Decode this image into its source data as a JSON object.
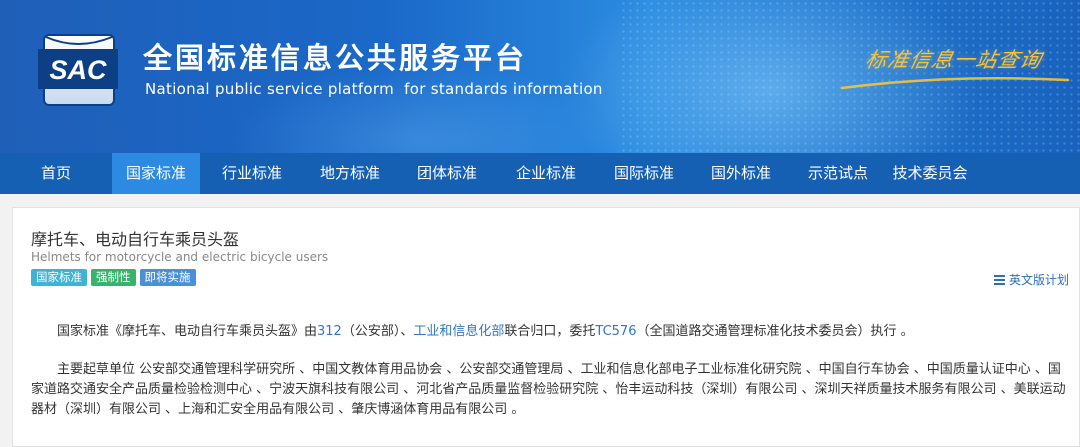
{
  "header": {
    "logo_text": "SAC",
    "title_cn": "全国标准信息公共服务平台",
    "title_en": "National public service platform  for standards information",
    "slogan": "标准信息一站查询"
  },
  "nav": {
    "items": [
      {
        "label": "首页",
        "active": false
      },
      {
        "label": "国家标准",
        "active": true
      },
      {
        "label": "行业标准",
        "active": false
      },
      {
        "label": "地方标准",
        "active": false
      },
      {
        "label": "团体标准",
        "active": false
      },
      {
        "label": "企业标准",
        "active": false
      },
      {
        "label": "国际标准",
        "active": false
      },
      {
        "label": "国外标准",
        "active": false
      },
      {
        "label": "示范试点",
        "active": false
      },
      {
        "label": "技术委员会",
        "active": false
      }
    ]
  },
  "standard": {
    "title": "摩托车、电动自行车乘员头盔",
    "title_en": "Helmets for motorcycle and electric bicycle users",
    "badges": [
      "国家标准",
      "强制性",
      "即将实施"
    ],
    "english_plan_link": "英文版计划",
    "para1": {
      "prefix": "国家标准《摩托车、电动自行车乘员头盔》由",
      "dept_code": "312",
      "dept_text": "（公安部）、",
      "ministry_link": "工业和信息化部",
      "mid_text": "联合归口，委托",
      "tc_link": "TC576",
      "suffix": "（全国道路交通管理标准化技术委员会）执行 。"
    },
    "para2": "主要起草单位 公安部交通管理科学研究所 、中国文教体育用品协会 、公安部交通管理局 、工业和信息化部电子工业标准化研究院 、中国自行车协会 、中国质量认证中心 、国家道路交通安全产品质量检验检测中心 、宁波天旗科技有限公司 、河北省产品质量监督检验研究院 、怡丰运动科技（深圳）有限公司 、深圳天祥质量技术服务有限公司 、美联运动器材（深圳）有限公司 、上海和汇安全用品有限公司 、肇庆博涵体育用品有限公司 。"
  }
}
